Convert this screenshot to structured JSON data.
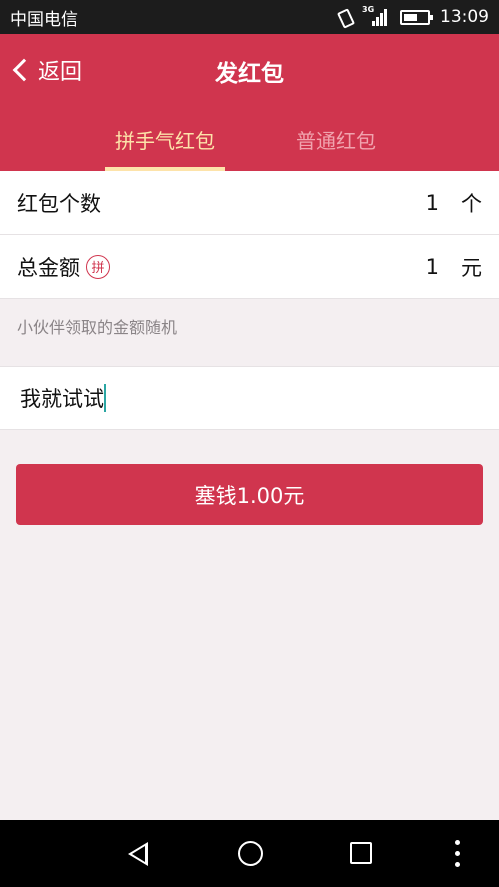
{
  "status_bar": {
    "carrier": "中国电信",
    "network": "3G",
    "time": "13:09"
  },
  "header": {
    "back_label": "返回",
    "title": "发红包",
    "tabs": [
      {
        "label": "拼手气红包",
        "active": true
      },
      {
        "label": "普通红包",
        "active": false
      }
    ]
  },
  "form": {
    "count": {
      "label": "红包个数",
      "value": "1",
      "unit": "个"
    },
    "amount": {
      "label": "总金额",
      "badge": "拼",
      "value": "1",
      "unit": "元"
    },
    "hint": "小伙伴领取的金额随机",
    "message": {
      "value": "我就试试"
    }
  },
  "submit": {
    "label": "塞钱1.00元"
  },
  "colors": {
    "brand": "#d0354e",
    "tab_active": "#fde3aa",
    "tab_inactive": "#f1a3ae",
    "background": "#f4eff1"
  },
  "icons": [
    "vibrate-icon",
    "signal-icon",
    "battery-icon",
    "chevron-left-icon",
    "nav-back-icon",
    "nav-home-icon",
    "nav-recent-icon",
    "nav-menu-icon"
  ]
}
